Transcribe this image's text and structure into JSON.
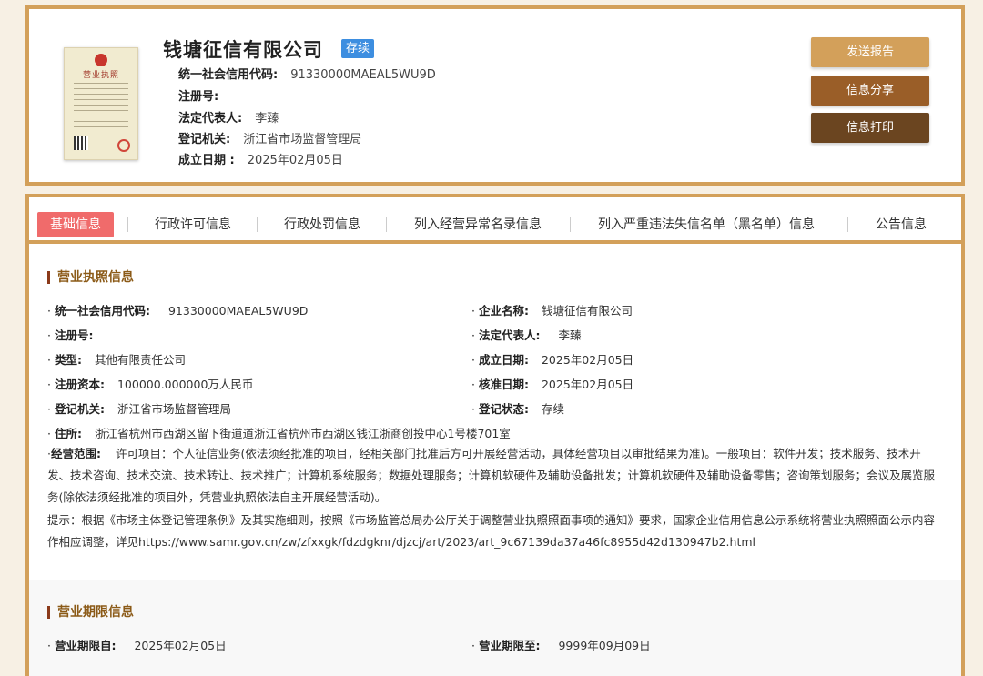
{
  "header": {
    "company_name": "钱塘征信有限公司",
    "status": "存续",
    "fields": [
      {
        "key": "统一社会信用代码:",
        "value": "91330000MAEAL5WU9D"
      },
      {
        "key": "注册号:",
        "value": ""
      },
      {
        "key": "法定代表人:",
        "value": "李臻"
      },
      {
        "key": "登记机关:",
        "value": "浙江省市场监督管理局"
      },
      {
        "key": "成立日期 :",
        "value": "2025年02月05日"
      }
    ],
    "license_title": "营业执照",
    "buttons": {
      "send_report": "发送报告",
      "share_info": "信息分享",
      "print_info": "信息打印"
    },
    "colors": {
      "send_report": "#d3a05a",
      "share_info": "#9a5e28",
      "print_info": "#6b4520"
    }
  },
  "tabs": [
    {
      "label": "基础信息",
      "active": true
    },
    {
      "label": "行政许可信息",
      "active": false
    },
    {
      "label": "行政处罚信息",
      "active": false
    },
    {
      "label": "列入经营异常名录信息",
      "active": false
    },
    {
      "label": "列入严重违法失信名单（黑名单）信息",
      "active": false
    },
    {
      "label": "公告信息",
      "active": false
    }
  ],
  "license_section": {
    "title": "营业执照信息",
    "left_fields": [
      {
        "key": "统一社会信用代码:",
        "value": "91330000MAEAL5WU9D"
      },
      {
        "key": "注册号:",
        "value": ""
      },
      {
        "key": "类型:",
        "value": "其他有限责任公司"
      },
      {
        "key": "注册资本:",
        "value": "100000.000000万人民币"
      },
      {
        "key": "登记机关:",
        "value": "浙江省市场监督管理局"
      },
      {
        "key": "住所:",
        "value": "浙江省杭州市西湖区留下街道道浙江省杭州市西湖区钱江浙商创投中心1号楼701室"
      }
    ],
    "right_fields": [
      {
        "key": "企业名称:",
        "value": "钱塘征信有限公司"
      },
      {
        "key": "法定代表人:",
        "value": "李臻"
      },
      {
        "key": "成立日期:",
        "value": "2025年02月05日"
      },
      {
        "key": "核准日期:",
        "value": "2025年02月05日"
      },
      {
        "key": "登记状态:",
        "value": "存续"
      }
    ],
    "scope_key": "经营范围:",
    "scope_value": "许可项目：个人征信业务(依法须经批准的项目，经相关部门批准后方可开展经营活动，具体经营项目以审批结果为准)。一般项目：软件开发；技术服务、技术开发、技术咨询、技术交流、技术转让、技术推广；计算机系统服务；数据处理服务；计算机软硬件及辅助设备批发；计算机软硬件及辅助设备零售；咨询策划服务；会议及展览服务(除依法须经批准的项目外，凭营业执照依法自主开展经营活动)。",
    "notice": "提示：根据《市场主体登记管理条例》及其实施细则，按照《市场监管总局办公厅关于调整营业执照照面事项的通知》要求，国家企业信用信息公示系统将营业执照照面公示内容作相应调整，详见https://www.samr.gov.cn/zw/zfxxgk/fdzdgknr/djzcj/art/2023/art_9c67139da37a46fc8955d42d130947b2.html"
  },
  "term_section": {
    "title": "营业期限信息",
    "from_key": "营业期限自:",
    "from_value": "2025年02月05日",
    "to_key": "营业期限至:",
    "to_value": "9999年09月09日"
  }
}
